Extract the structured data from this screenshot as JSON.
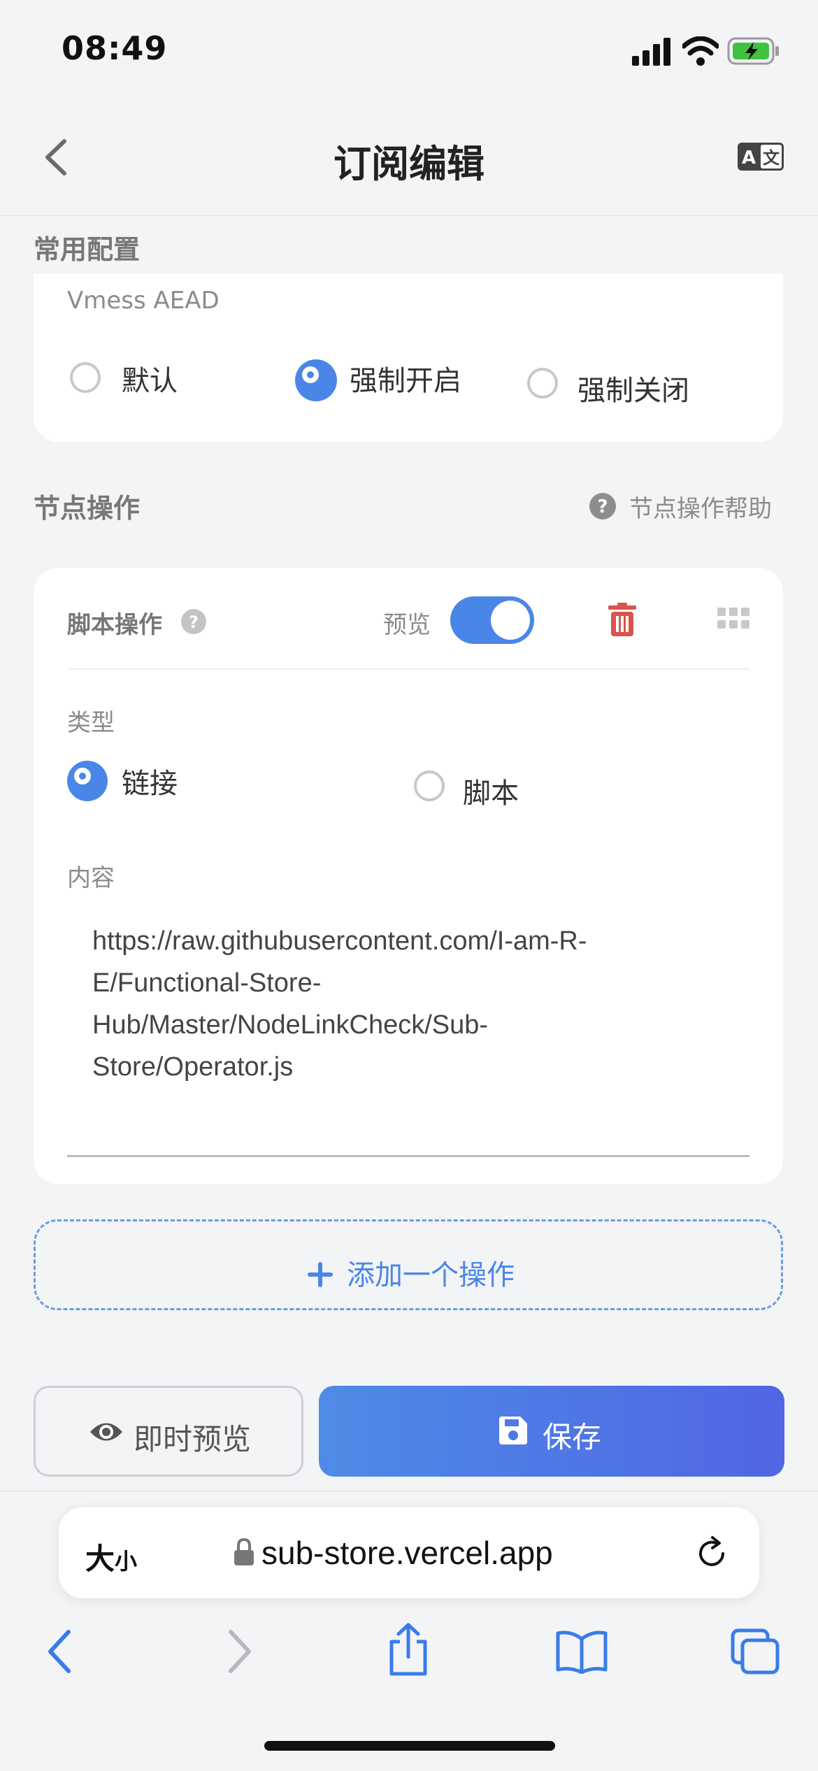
{
  "status_bar": {
    "time": "08:49"
  },
  "header": {
    "title": "订阅编辑"
  },
  "common_config": {
    "section_title": "常用配置",
    "vmess_label": "Vmess AEAD",
    "options": [
      "默认",
      "强制开启",
      "强制关闭"
    ],
    "selected": "强制开启"
  },
  "node_ops": {
    "section_title": "节点操作",
    "help_label": "节点操作帮助"
  },
  "script_op": {
    "title": "脚本操作",
    "preview_label": "预览",
    "preview_enabled": true,
    "type_label": "类型",
    "type_options": [
      "链接",
      "脚本"
    ],
    "type_selected": "链接",
    "content_label": "内容",
    "content_lines": [
      "https://raw.githubusercontent.com/I-am-R-",
      "E/Functional-Store-",
      "Hub/Master/NodeLinkCheck/Sub-",
      "Store/Operator.js"
    ]
  },
  "add_operation": {
    "label": "添加一个操作"
  },
  "actions": {
    "preview_label": "即时预览",
    "save_label": "保存"
  },
  "safari": {
    "size_label_big": "大",
    "size_label_small": "小",
    "url": "sub-store.vercel.app"
  },
  "icons": {
    "back": "chevron-left-icon",
    "translate": "translate-icon",
    "help": "question-circle-icon",
    "delete": "trash-icon",
    "drag": "grip-icon",
    "plus": "plus-icon",
    "eye": "eye-icon",
    "save": "floppy-disk-icon",
    "lock": "lock-icon",
    "reload": "reload-icon"
  },
  "colors": {
    "accent": "#4a86e8",
    "danger": "#d9534f",
    "save_gradient_end": "#5066e3"
  }
}
